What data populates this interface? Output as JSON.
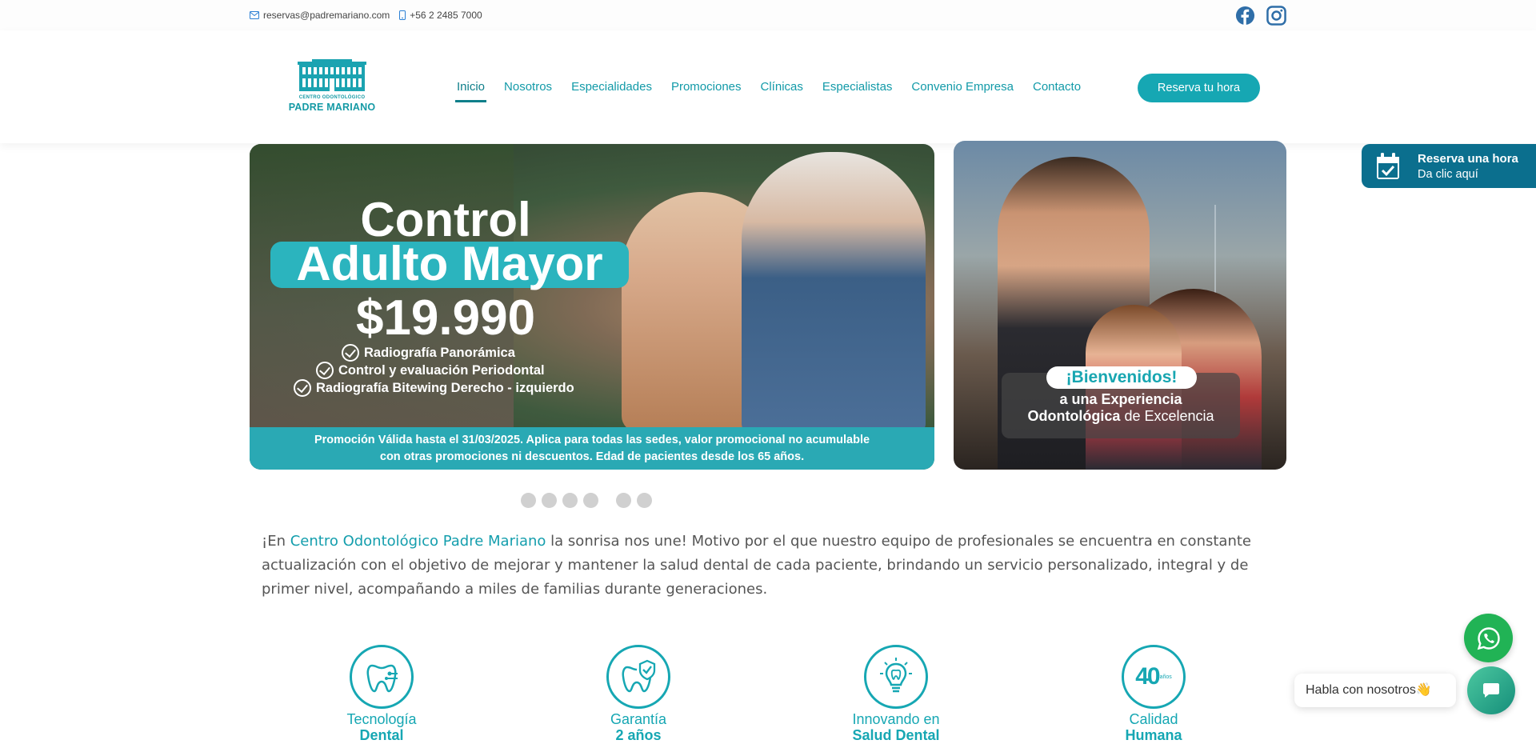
{
  "topbar": {
    "email": "reservas@padremariano.com",
    "phone": "+56 2 2485 7000",
    "icons": [
      "mail-icon",
      "phone-icon",
      "facebook-icon",
      "instagram-icon"
    ]
  },
  "logo": {
    "line1": "CENTRO ODONTOLÓGICO",
    "line2": "PADRE MARIANO"
  },
  "nav": {
    "items": [
      {
        "label": "Inicio",
        "active": true
      },
      {
        "label": "Nosotros"
      },
      {
        "label": "Especialidades"
      },
      {
        "label": "Promociones"
      },
      {
        "label": "Clínicas"
      },
      {
        "label": "Especialistas"
      },
      {
        "label": "Convenio Empresa"
      },
      {
        "label": "Contacto"
      }
    ],
    "cta": "Reserva tu hora"
  },
  "slide_main": {
    "line1": "Control",
    "line2": "Adulto Mayor",
    "price": "$19.990",
    "checks": [
      "Radiografía Panorámica",
      "Control y evaluación Periodontal",
      "Radiografía Bitewing Derecho - izquierdo"
    ],
    "footer1": "Promoción Válida hasta el 31/03/2025. Aplica para todas las sedes, valor promocional no acumulable",
    "footer2": "con otras promociones ni descuentos. Edad de pacientes desde los 65 años."
  },
  "slide_side": {
    "badge": "¡Bienvenidos!",
    "line1": "a una Experiencia",
    "line2_bold": "Odontológica",
    "line2_rest": " de Excelencia"
  },
  "carousel": {
    "dot_count": 6
  },
  "intro": {
    "prefix": "¡En ",
    "highlight": "Centro Odontológico Padre Mariano",
    "text": " la sonrisa nos une! Motivo por el que nuestro equipo de profesionales se encuentra en constante actualización con el objetivo de mejorar y mantener la salud dental de cada paciente, brindando un servicio personalizado, integral y de primer nivel, acompañando a miles de familias durante generaciones."
  },
  "features": [
    {
      "t1": "Tecnología",
      "t2": "Dental",
      "icon": "tooth-tech-icon"
    },
    {
      "t1": "Garantía",
      "t2": "2 años",
      "icon": "tooth-check-icon"
    },
    {
      "t1": "Innovando en",
      "t2": "Salud Dental",
      "icon": "lightbulb-tooth-icon"
    },
    {
      "t1": "Calidad",
      "t2": "Humana",
      "icon": "forty-years-icon",
      "badge_num": "40",
      "badge_sub": "años"
    }
  ],
  "float_reserve": {
    "title": "Reserva una hora",
    "subtitle": "Da clic aquí"
  },
  "chat": {
    "bubble": "Habla con nosotros",
    "emoji": "👋"
  },
  "colors": {
    "accent": "#16a7b3",
    "nav_text": "#129aa8",
    "float_blue": "#0b6f8e",
    "whatsapp": "#21b355"
  }
}
